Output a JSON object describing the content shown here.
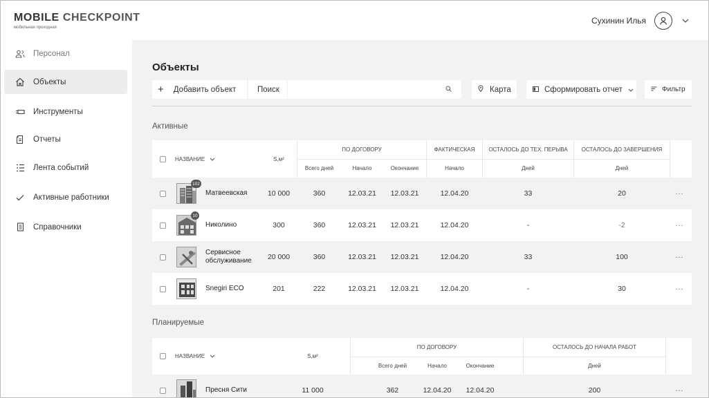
{
  "header": {
    "logo_bold": "MOBILE",
    "logo_light": "CHECKPOINT",
    "logo_subtitle": "мобильная проходная",
    "user_name": "Сухинин Илья"
  },
  "sidebar": {
    "items": [
      {
        "label": "Персонал",
        "icon": "people-icon"
      },
      {
        "label": "Объекты",
        "icon": "home-icon"
      },
      {
        "label": "Инструменты",
        "icon": "tool-icon"
      },
      {
        "label": "Отчеты",
        "icon": "document-icon"
      },
      {
        "label": "Лента событий",
        "icon": "list-icon"
      },
      {
        "label": "Активные работники",
        "icon": "check-icon"
      },
      {
        "label": "Справочники",
        "icon": "book-icon"
      }
    ]
  },
  "main": {
    "title": "Объекты",
    "toolbar": {
      "add_label": "Добавить объект",
      "search_label": "Поиск",
      "search_value": "",
      "map_label": "Карта",
      "report_label": "Сформировать отчет",
      "filter_label": "Фильтр"
    },
    "active_section": {
      "title": "Активные",
      "headers": {
        "name": "НАЗВАНИЕ",
        "area": "S,м²",
        "contract": "ПО ДОГОВОРУ",
        "actual": "ФАКТИЧЕСКАЯ",
        "tech_break": "ОСТАЛОСЬ ДО ТЕХ. ПЕРЫВА",
        "completion": "ОСТАЛОСЬ ДО ЗАВЕРШЕНИЯ",
        "total_days": "Всего дней",
        "start": "Начало",
        "end": "Окончание",
        "actual_start": "Начало",
        "days1": "Дней",
        "days2": "Дней"
      },
      "rows": [
        {
          "badge": "102",
          "name": "Матвеевская",
          "area": "10 000",
          "total_days": "360",
          "start": "12.03.21",
          "end": "12.03.21",
          "actual_start": "12.04.20",
          "tech_break": "33",
          "completion": "20",
          "more": "···"
        },
        {
          "badge": "10",
          "name": "Николино",
          "area": "300",
          "total_days": "360",
          "start": "12.03.21",
          "end": "12.03.21",
          "actual_start": "12.04.20",
          "tech_break": "-",
          "completion": "-2",
          "more": "···"
        },
        {
          "badge": "",
          "name": "Сервисное обслуживание",
          "area": "20 000",
          "total_days": "360",
          "start": "12.03.21",
          "end": "12.03.21",
          "actual_start": "12.04.20",
          "tech_break": "33",
          "completion": "100",
          "more": "···"
        },
        {
          "badge": "",
          "name": "Snegiri ECO",
          "area": "201",
          "total_days": "222",
          "start": "12.03.21",
          "end": "12.03.21",
          "actual_start": "12.04.20",
          "tech_break": "-",
          "completion": "30",
          "more": "···"
        }
      ]
    },
    "planned_section": {
      "title": "Планируемые",
      "headers": {
        "name": "НАЗВАНИЕ",
        "area": "S,м²",
        "contract": "ПО ДОГОВОРУ",
        "until_start": "ОСТАЛОСЬ ДО НАЧАЛА РАБОТ",
        "total_days": "Всего дней",
        "start": "Начало",
        "end": "Окончание",
        "days": "Дней"
      },
      "rows": [
        {
          "name": "Пресня Сити",
          "area": "11 000",
          "total_days": "362",
          "start": "12.04.20",
          "end": "12.04.20",
          "until_start": "200",
          "more": "···"
        }
      ]
    }
  }
}
